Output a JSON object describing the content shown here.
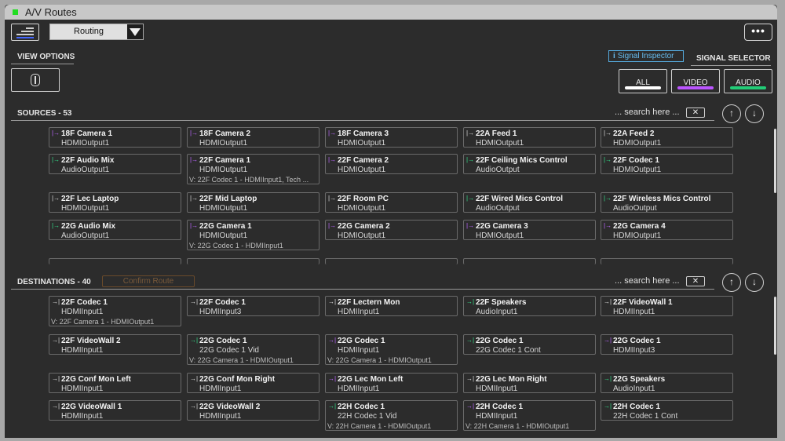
{
  "window": {
    "title": "A/V Routes"
  },
  "toolbar": {
    "mode_selected": "Routing",
    "more_label": "•••"
  },
  "view_options": {
    "label": "VIEW OPTIONS"
  },
  "signal": {
    "inspector_label": "Signal Inspector",
    "selector_label": "SIGNAL SELECTOR",
    "buttons": [
      {
        "label": "ALL",
        "color": "#ffffff"
      },
      {
        "label": "VIDEO",
        "color": "#bb55ff"
      },
      {
        "label": "AUDIO",
        "color": "#22cc77"
      }
    ]
  },
  "sources": {
    "header": "SOURCES - 53",
    "search_placeholder": "... search here ...",
    "clear_label": "✕",
    "items": [
      {
        "name": "18F Camera 1",
        "port": "HDMIOutput1",
        "kind": "video",
        "icon": "input-arrow-icon",
        "route": ""
      },
      {
        "name": "18F Camera 2",
        "port": "HDMIOutput1",
        "kind": "video",
        "icon": "input-arrow-icon",
        "route": ""
      },
      {
        "name": "18F Camera 3",
        "port": "HDMIOutput1",
        "kind": "video",
        "icon": "input-arrow-icon",
        "route": ""
      },
      {
        "name": "22A Feed 1",
        "port": "HDMIOutput1",
        "kind": "hdmi",
        "icon": "input-arrow-icon",
        "route": ""
      },
      {
        "name": "22A Feed 2",
        "port": "HDMIOutput1",
        "kind": "hdmi",
        "icon": "input-arrow-icon",
        "route": ""
      },
      {
        "name": "22F Audio Mix",
        "port": "AudioOutput1",
        "kind": "audio",
        "icon": "input-arrow-icon",
        "route": ""
      },
      {
        "name": "22F Camera 1",
        "port": "HDMIOutput1",
        "kind": "video",
        "icon": "input-arrow-icon",
        "route": "V: 22F Codec 1 - HDMIInput1, Tech ..."
      },
      {
        "name": "22F Camera 2",
        "port": "HDMIOutput1",
        "kind": "video",
        "icon": "input-arrow-icon",
        "route": ""
      },
      {
        "name": "22F Ceiling Mics Control",
        "port": "AudioOutput",
        "kind": "audio",
        "icon": "input-arrow-icon",
        "route": ""
      },
      {
        "name": "22F Codec 1",
        "port": "HDMIOutput1",
        "kind": "audio",
        "icon": "input-arrow-icon",
        "route": ""
      },
      {
        "name": "22F Lec Laptop",
        "port": "HDMIOutput1",
        "kind": "hdmi",
        "icon": "input-arrow-icon",
        "route": ""
      },
      {
        "name": "22F Mid Laptop",
        "port": "HDMIOutput1",
        "kind": "hdmi",
        "icon": "input-arrow-icon",
        "route": ""
      },
      {
        "name": "22F Room PC",
        "port": "HDMIOutput1",
        "kind": "hdmi",
        "icon": "input-arrow-icon",
        "route": ""
      },
      {
        "name": "22F Wired Mics Control",
        "port": "AudioOutput",
        "kind": "audio",
        "icon": "input-arrow-icon",
        "route": ""
      },
      {
        "name": "22F Wireless Mics Control",
        "port": "AudioOutput",
        "kind": "audio",
        "icon": "input-arrow-icon",
        "route": ""
      },
      {
        "name": "22G Audio Mix",
        "port": "AudioOutput1",
        "kind": "audio",
        "icon": "input-arrow-icon",
        "route": ""
      },
      {
        "name": "22G Camera 1",
        "port": "HDMIOutput1",
        "kind": "video",
        "icon": "input-arrow-icon",
        "route": "V: 22G Codec 1 - HDMIInput1"
      },
      {
        "name": "22G Camera 2",
        "port": "HDMIOutput1",
        "kind": "video",
        "icon": "input-arrow-icon",
        "route": ""
      },
      {
        "name": "22G Camera 3",
        "port": "HDMIOutput1",
        "kind": "video",
        "icon": "input-arrow-icon",
        "route": ""
      },
      {
        "name": "22G Camera 4",
        "port": "HDMIOutput1",
        "kind": "video",
        "icon": "input-arrow-icon",
        "route": ""
      }
    ]
  },
  "destinations": {
    "header": "DESTINATIONS - 40",
    "confirm_label": "Confirm Route",
    "search_placeholder": "... search here ...",
    "clear_label": "✕",
    "items": [
      {
        "name": "22F Codec 1",
        "port": "HDMIInput1",
        "kind": "hdmi",
        "icon": "output-arrow-icon",
        "route": "V: 22F Camera 1 - HDMIOutput1"
      },
      {
        "name": "22F Codec 1",
        "port": "HDMIInput3",
        "kind": "hdmi",
        "icon": "output-arrow-icon",
        "route": ""
      },
      {
        "name": "22F Lectern Mon",
        "port": "HDMIInput1",
        "kind": "hdmi",
        "icon": "output-arrow-icon",
        "route": ""
      },
      {
        "name": "22F Speakers",
        "port": "AudioInput1",
        "kind": "audio",
        "icon": "output-arrow-icon",
        "route": ""
      },
      {
        "name": "22F VideoWall 1",
        "port": "HDMIInput1",
        "kind": "hdmi",
        "icon": "output-arrow-icon",
        "route": ""
      },
      {
        "name": "22F VideoWall 2",
        "port": "HDMIInput1",
        "kind": "hdmi",
        "icon": "output-arrow-icon",
        "route": ""
      },
      {
        "name": "22G Codec 1",
        "port": "22G Codec 1 Vid",
        "kind": "audio",
        "icon": "output-arrow-icon",
        "route": "V: 22G Camera 1 - HDMIOutput1"
      },
      {
        "name": "22G Codec 1",
        "port": "HDMIInput1",
        "kind": "video",
        "icon": "output-arrow-icon",
        "route": "V: 22G Camera 1 - HDMIOutput1"
      },
      {
        "name": "22G Codec 1",
        "port": "22G Codec 1 Cont",
        "kind": "audio",
        "icon": "output-arrow-icon",
        "route": ""
      },
      {
        "name": "22G Codec 1",
        "port": "HDMIInput3",
        "kind": "video",
        "icon": "output-arrow-icon",
        "route": ""
      },
      {
        "name": "22G Conf Mon Left",
        "port": "HDMIInput1",
        "kind": "hdmi",
        "icon": "output-arrow-icon",
        "route": ""
      },
      {
        "name": "22G Conf Mon Right",
        "port": "HDMIInput1",
        "kind": "hdmi",
        "icon": "output-arrow-icon",
        "route": ""
      },
      {
        "name": "22G Lec Mon Left",
        "port": "HDMIInput1",
        "kind": "video",
        "icon": "output-arrow-icon",
        "route": ""
      },
      {
        "name": "22G Lec Mon Right",
        "port": "HDMIInput1",
        "kind": "hdmi",
        "icon": "output-arrow-icon",
        "route": ""
      },
      {
        "name": "22G Speakers",
        "port": "AudioInput1",
        "kind": "audio",
        "icon": "output-arrow-icon",
        "route": ""
      },
      {
        "name": "22G VideoWall 1",
        "port": "HDMIInput1",
        "kind": "hdmi",
        "icon": "output-arrow-icon",
        "route": ""
      },
      {
        "name": "22G VideoWall 2",
        "port": "HDMIInput1",
        "kind": "hdmi",
        "icon": "output-arrow-icon",
        "route": ""
      },
      {
        "name": "22H Codec 1",
        "port": "22H Codec 1 Vid",
        "kind": "audio",
        "icon": "output-arrow-icon",
        "route": "V: 22H Camera 1 - HDMIOutput1"
      },
      {
        "name": "22H Codec 1",
        "port": "HDMIInput1",
        "kind": "video",
        "icon": "output-arrow-icon",
        "route": "V: 22H Camera 1 - HDMIOutput1"
      },
      {
        "name": "22H Codec 1",
        "port": "22H Codec 1 Cont",
        "kind": "audio",
        "icon": "output-arrow-icon",
        "route": ""
      }
    ]
  }
}
